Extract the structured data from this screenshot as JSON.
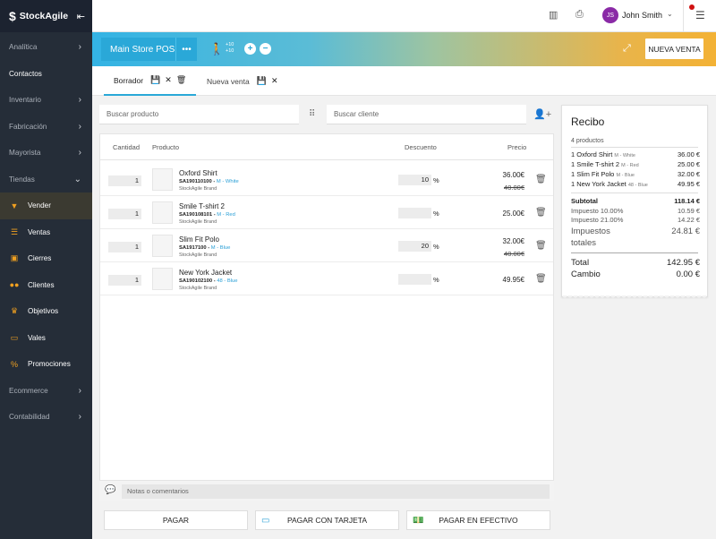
{
  "sidebar": {
    "brand": "StockAgile",
    "items": [
      {
        "label": "Analítica"
      },
      {
        "label": "Contactos"
      },
      {
        "label": "Inventario"
      },
      {
        "label": "Fabricación"
      },
      {
        "label": "Mayorista"
      },
      {
        "label": "Tiendas"
      }
    ],
    "store_sub": [
      {
        "label": "Vender",
        "icon": "basket-icon"
      },
      {
        "label": "Ventas",
        "icon": "list-icon"
      },
      {
        "label": "Cierres",
        "icon": "register-icon"
      },
      {
        "label": "Clientes",
        "icon": "people-icon"
      },
      {
        "label": "Objetivos",
        "icon": "trophy-icon"
      },
      {
        "label": "Vales",
        "icon": "voucher-icon"
      },
      {
        "label": "Promociones",
        "icon": "percent-icon"
      }
    ],
    "bottom": [
      {
        "label": "Ecommerce"
      },
      {
        "label": "Contabilidad"
      }
    ]
  },
  "topbar": {
    "avatar_initials": "JS",
    "user_name": "John Smith"
  },
  "storebar": {
    "store_name": "Main Store POS",
    "counter_in": "+10",
    "counter_out": "+10",
    "new_sale_label": "NUEVA VENTA"
  },
  "tabs": [
    {
      "label": "Borrador"
    },
    {
      "label": "Nueva venta"
    }
  ],
  "search": {
    "product_placeholder": "Buscar producto",
    "client_placeholder": "Buscar cliente"
  },
  "table": {
    "headers": {
      "qty": "Cantidad",
      "product": "Producto",
      "discount": "Descuento",
      "price": "Precio"
    },
    "rows": [
      {
        "qty": "1",
        "name": "Oxford Shirt",
        "sku": "SA190110100",
        "variant": "M - White",
        "brand": "StockAgile Brand",
        "discount": "10",
        "price": "36.00€",
        "old_price": "40.00€"
      },
      {
        "qty": "1",
        "name": "Smile T-shirt 2",
        "sku": "SA190108101",
        "variant": "M - Red",
        "brand": "StockAgile Brand",
        "discount": "",
        "price": "25.00€",
        "old_price": ""
      },
      {
        "qty": "1",
        "name": "Slim Fit Polo",
        "sku": "SA1917100",
        "variant": "M - Blue",
        "brand": "StockAgile Brand",
        "discount": "20",
        "price": "32.00€",
        "old_price": "40.00€"
      },
      {
        "qty": "1",
        "name": "New York Jacket",
        "sku": "SA190102100",
        "variant": "48 - Blue",
        "brand": "StockAgile Brand",
        "discount": "",
        "price": "49.95€",
        "old_price": ""
      }
    ],
    "pct_symbol": "%",
    "notes_placeholder": "Notas o comentarios"
  },
  "pay": {
    "pay": "PAGAR",
    "card": "PAGAR CON TARJETA",
    "cash": "PAGAR EN EFECTIVO"
  },
  "receipt": {
    "title": "Recibo",
    "count": "4 productos",
    "items": [
      {
        "qty": "1",
        "name": "Oxford Shirt",
        "variant": "M - White",
        "amount": "36.00 €"
      },
      {
        "qty": "1",
        "name": "Smile T-shirt 2",
        "variant": "M - Red",
        "amount": "25.00 €"
      },
      {
        "qty": "1",
        "name": "Slim Fit Polo",
        "variant": "M - Blue",
        "amount": "32.00 €"
      },
      {
        "qty": "1",
        "name": "New York Jacket",
        "variant": "48 - Blue",
        "amount": "49.95 €"
      }
    ],
    "subtotal_label": "Subtotal",
    "subtotal": "118.14 €",
    "tax1_label": "Impuesto 10.00%",
    "tax1": "10.59 €",
    "tax2_label": "Impuesto 21.00%",
    "tax2": "14.22 €",
    "tax_total_label": "Impuestos totales",
    "tax_total": "24.81 €",
    "total_label": "Total",
    "total": "142.95 €",
    "change_label": "Cambio",
    "change": "0.00 €"
  },
  "colors": {
    "accent": "#2aa8d8",
    "sidebar": "#252d38",
    "sidebar_icon": "#f0a020"
  }
}
